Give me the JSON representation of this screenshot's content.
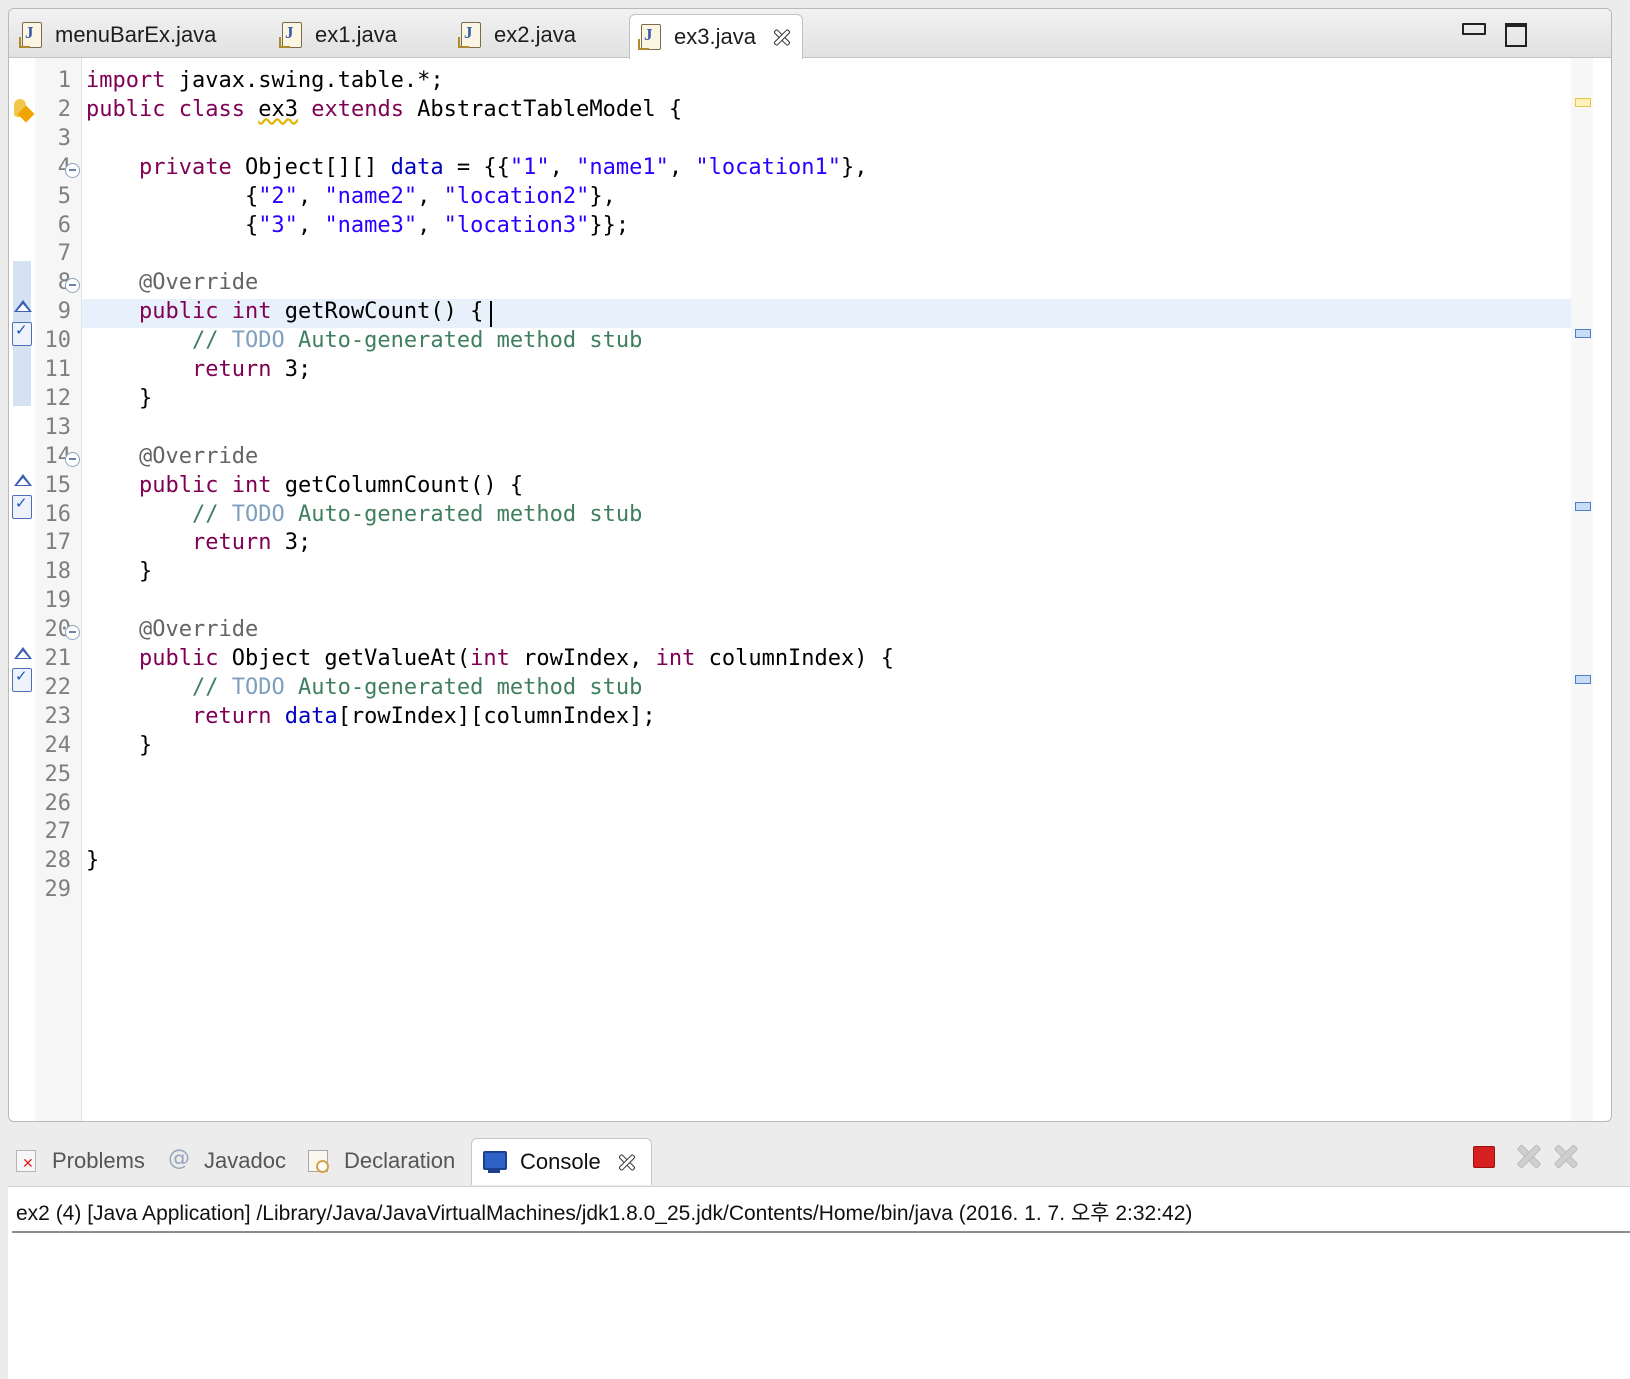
{
  "editor": {
    "tabs": [
      {
        "label": "menuBarEx.java",
        "active": false
      },
      {
        "label": "ex1.java",
        "active": false
      },
      {
        "label": "ex2.java",
        "active": false
      },
      {
        "label": "ex3.java",
        "active": true
      }
    ],
    "current_line": 9,
    "line_numbers": [
      "1",
      "2",
      "3",
      "4",
      "5",
      "6",
      "7",
      "8",
      "9",
      "10",
      "11",
      "12",
      "13",
      "14",
      "15",
      "16",
      "17",
      "18",
      "19",
      "20",
      "21",
      "22",
      "23",
      "24",
      "25",
      "26",
      "27",
      "28",
      "29"
    ],
    "code_lines": [
      "import javax.swing.table.*;",
      "public class ex3 extends AbstractTableModel {",
      "",
      "    private Object[][] data = {{\"1\", \"name1\", \"location1\"},",
      "            {\"2\", \"name2\", \"location2\"},",
      "            {\"3\", \"name3\", \"location3\"}};",
      "",
      "    @Override",
      "    public int getRowCount() {",
      "        // TODO Auto-generated method stub",
      "        return 3;",
      "    }",
      "",
      "    @Override",
      "    public int getColumnCount() {",
      "        // TODO Auto-generated method stub",
      "        return 3;",
      "    }",
      "",
      "    @Override",
      "    public Object getValueAt(int rowIndex, int columnIndex) {",
      "        // TODO Auto-generated method stub",
      "        return data[rowIndex][columnIndex];",
      "    }",
      "",
      "",
      "",
      "}",
      ""
    ],
    "colors": {
      "keyword": "#7f0055",
      "string": "#2a00ff",
      "field": "#0000c0",
      "comment": "#3f7f5f",
      "todo": "#7f9fbf",
      "annotation": "#646464",
      "current_line_highlight": "#e8f1fb"
    }
  },
  "bottom_panel": {
    "tabs": [
      {
        "label": "Problems",
        "icon": "problems-icon",
        "active": false
      },
      {
        "label": "Javadoc",
        "icon": "javadoc-icon",
        "active": false
      },
      {
        "label": "Declaration",
        "icon": "declaration-icon",
        "active": false
      },
      {
        "label": "Console",
        "icon": "console-icon",
        "active": true
      }
    ],
    "launch_info": "ex2 (4) [Java Application] /Library/Java/JavaVirtualMachines/jdk1.8.0_25.jdk/Contents/Home/bin/java (2016. 1. 7. 오후 2:32:42)",
    "colors": {
      "terminate": "#d61f1f"
    }
  }
}
